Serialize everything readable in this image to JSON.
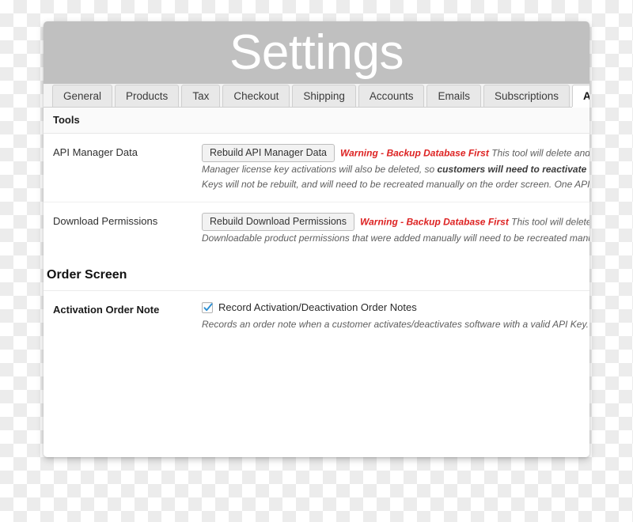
{
  "header": {
    "title": "Settings"
  },
  "tabs": [
    {
      "label": "General",
      "active": false
    },
    {
      "label": "Products",
      "active": false
    },
    {
      "label": "Tax",
      "active": false
    },
    {
      "label": "Checkout",
      "active": false
    },
    {
      "label": "Shipping",
      "active": false
    },
    {
      "label": "Accounts",
      "active": false
    },
    {
      "label": "Emails",
      "active": false
    },
    {
      "label": "Subscriptions",
      "active": false
    },
    {
      "label": "API Manager",
      "active": true
    }
  ],
  "sections": {
    "tools": {
      "title": "Tools",
      "rows": {
        "api_manager_data": {
          "label": "API Manager Data",
          "button": "Rebuild API Manager Data",
          "warning": "Warning - Backup Database First",
          "desc_line1": "This tool will delete and rebuild a",
          "desc_line2_a": "Manager license key activations will also be deleted, so ",
          "desc_line2_b": "customers will need to reactivate software ",
          "desc_line3": "Keys will not be rebuilt, and will need to be recreated manually on the order screen. One API Key will b"
        },
        "download_permissions": {
          "label": "Download Permissions",
          "button": "Rebuild Download Permissions",
          "warning": "Warning - Backup Database First",
          "desc_line1": "This tool will delete and rebu",
          "desc_line2": "Downloadable product permissions that were added manually will need to be recreated manually on"
        }
      }
    },
    "order_screen": {
      "title": "Order Screen",
      "rows": {
        "activation_order_note": {
          "label": "Activation Order Note",
          "checkbox_label": "Record Activation/Deactivation Order Notes",
          "checked": true,
          "desc": "Records an order note when a customer activates/deactivates software with a valid API Key."
        }
      }
    }
  },
  "colors": {
    "warning_red": "#dd2222",
    "checkbox_blue": "#2a8fd4",
    "header_gray": "#c0c0c0"
  }
}
